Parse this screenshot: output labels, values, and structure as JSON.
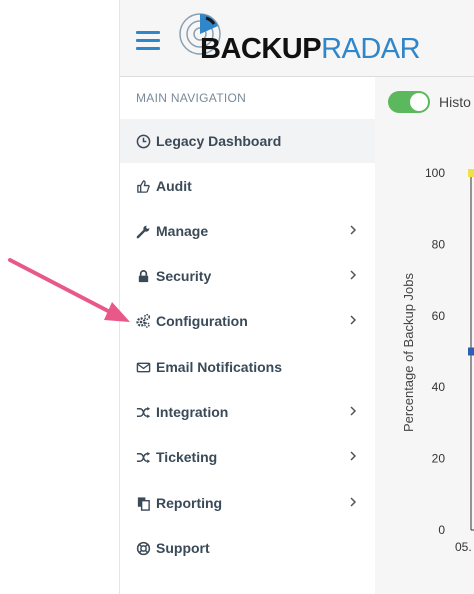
{
  "header": {
    "logo_backup": "BACKUP",
    "logo_radar": "RADAR"
  },
  "sidebar": {
    "header": "MAIN NAVIGATION",
    "items": [
      {
        "label": "Legacy Dashboard",
        "icon": "clock-icon",
        "has_submenu": false,
        "active": true
      },
      {
        "label": "Audit",
        "icon": "thumbs-up-icon",
        "has_submenu": false
      },
      {
        "label": "Manage",
        "icon": "wrench-icon",
        "has_submenu": true
      },
      {
        "label": "Security",
        "icon": "lock-icon",
        "has_submenu": true
      },
      {
        "label": "Configuration",
        "icon": "gears-icon",
        "has_submenu": true
      },
      {
        "label": "Email Notifications",
        "icon": "envelope-icon",
        "has_submenu": false
      },
      {
        "label": "Integration",
        "icon": "shuffle-icon",
        "has_submenu": true
      },
      {
        "label": "Ticketing",
        "icon": "shuffle-icon",
        "has_submenu": true
      },
      {
        "label": "Reporting",
        "icon": "copy-icon",
        "has_submenu": true
      },
      {
        "label": "Support",
        "icon": "life-ring-icon",
        "has_submenu": false
      }
    ]
  },
  "content": {
    "toggle_label": "Histo",
    "toggle_on": true
  },
  "chart_data": {
    "type": "line",
    "ylabel": "Percentage of Backup Jobs",
    "yticks": [
      "100",
      "80",
      "60",
      "40",
      "20",
      "0"
    ],
    "ylim": [
      0,
      100
    ],
    "xtick_first": "05.",
    "series": [
      {
        "color": "#f0e04a",
        "values": [
          100
        ]
      },
      {
        "color": "#2f5fb3",
        "values": [
          50
        ]
      }
    ]
  },
  "annotation": {
    "arrow_color": "#e8598a"
  }
}
